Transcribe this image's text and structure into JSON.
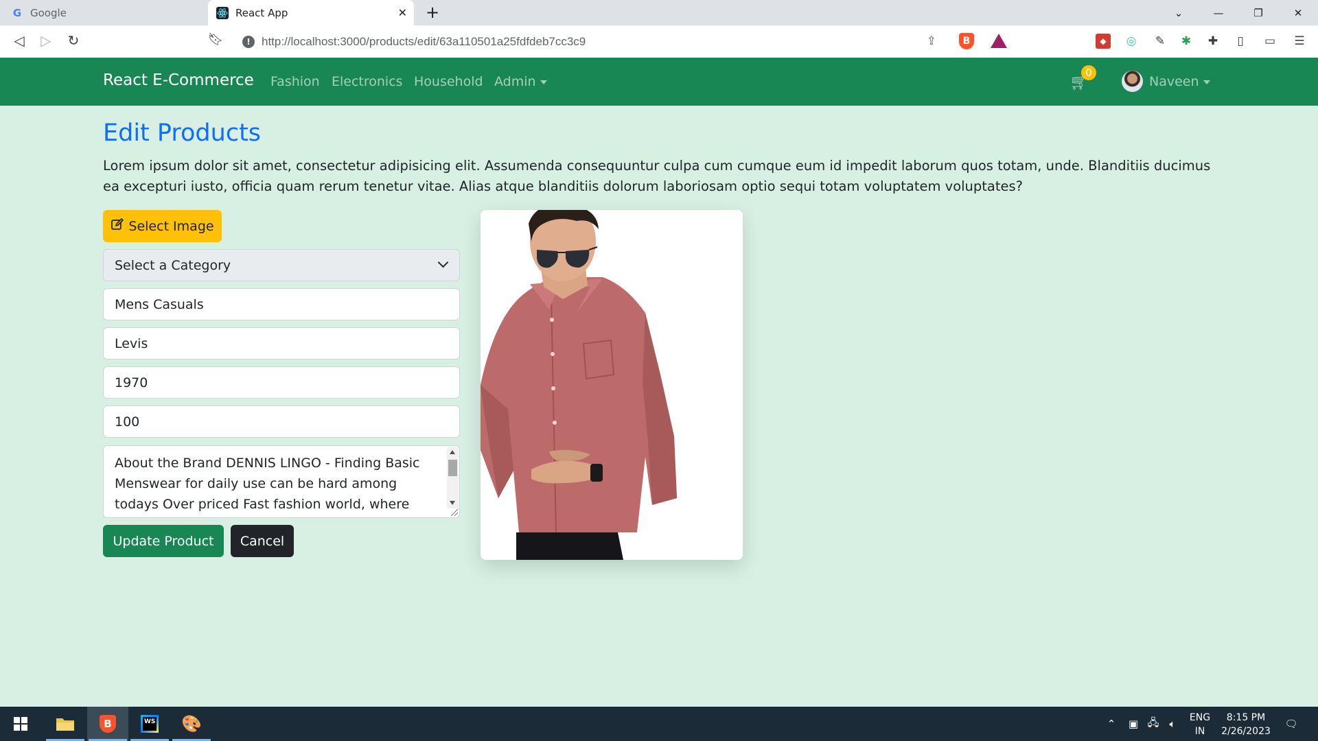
{
  "browser": {
    "tabs": [
      {
        "title": "Google",
        "active": false
      },
      {
        "title": "React App",
        "active": true
      }
    ],
    "url": "http://localhost:3000/products/edit/63a110501a25fdfdeb7cc3c9"
  },
  "navbar": {
    "brand": "React E-Commerce",
    "links": [
      "Fashion",
      "Electronics",
      "Household",
      "Admin"
    ],
    "cart_count": "0",
    "user": "Naveen"
  },
  "page": {
    "title": "Edit Products",
    "description": "Lorem ipsum dolor sit amet, consectetur adipisicing elit. Assumenda consequuntur culpa cum cumque eum id impedit laborum quos totam, unde. Blanditiis ducimus ea excepturi iusto, officia quam rerum tenetur vitae. Alias atque blanditiis dolorum laboriosam optio sequi totam voluptatem voluptates?"
  },
  "form": {
    "select_image_label": "Select Image",
    "category_selected": "Select a Category",
    "name": "Mens Casuals",
    "brand": "Levis",
    "price": "1970",
    "quantity": "100",
    "description_visible": "About the Brand DENNIS LINGO - Finding Basic Menswear for daily use can be hard among todays Over priced Fast fashion world, where trends",
    "update_label": "Update Product",
    "cancel_label": "Cancel"
  },
  "taskbar": {
    "lang_line1": "ENG",
    "lang_line2": "IN",
    "time": "8:15 PM",
    "date": "2/26/2023"
  },
  "colors": {
    "navbar": "#198754",
    "title": "#0d6efd",
    "select_image_button": "#ffc107",
    "page_background": "#d8f0e4"
  }
}
